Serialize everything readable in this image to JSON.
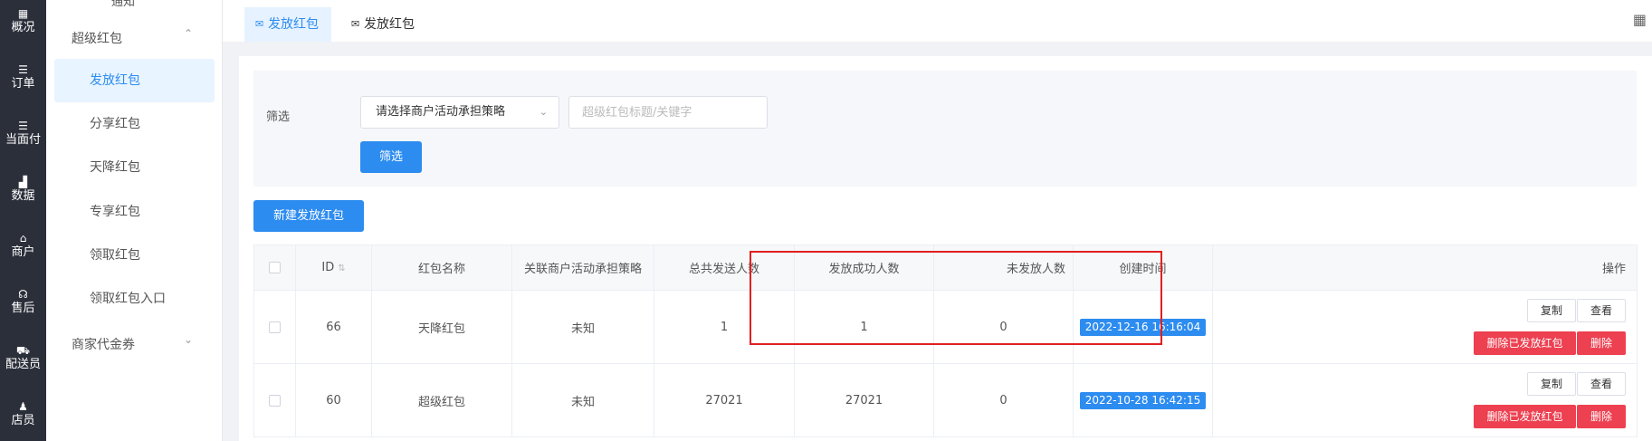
{
  "rail": [
    {
      "icon": "▦",
      "label": "概况"
    },
    {
      "icon": "☰",
      "label": "订单"
    },
    {
      "icon": "☰",
      "label": "当面付"
    },
    {
      "icon": "▟",
      "label": "数据"
    },
    {
      "icon": "⌂",
      "label": "商户"
    },
    {
      "icon": "☊",
      "label": "售后"
    },
    {
      "icon": "⛟",
      "label": "配送员"
    },
    {
      "icon": "♟",
      "label": "店员"
    }
  ],
  "submenu": {
    "partial_label": "通知",
    "group_super": "超级红包",
    "items": [
      "发放红包",
      "分享红包",
      "天降红包",
      "专享红包",
      "领取红包",
      "领取红包入口"
    ],
    "group_coupon": "商家代金券"
  },
  "tabs": [
    {
      "label": "发放红包",
      "icon": "✉"
    },
    {
      "label": "发放红包",
      "icon": "✉"
    }
  ],
  "filter": {
    "label": "筛选",
    "select_value": "请选择商户活动承担策略",
    "keyword_placeholder": "超级红包标题/关键字",
    "button": "筛选"
  },
  "new_button": "新建发放红包",
  "table": {
    "headers": {
      "id": "ID",
      "name": "红包名称",
      "strategy": "关联商户活动承担策略",
      "total": "总共发送人数",
      "success": "发放成功人数",
      "unsent": "未发放人数",
      "created": "创建时间",
      "ops": "操作"
    },
    "rows": [
      {
        "id": "66",
        "name": "天降红包",
        "strategy": "未知",
        "total": "1",
        "success": "1",
        "unsent": "0",
        "created": "2022-12-16 16:16:04"
      },
      {
        "id": "60",
        "name": "超级红包",
        "strategy": "未知",
        "total": "27021",
        "success": "27021",
        "unsent": "0",
        "created": "2022-10-28 16:42:15"
      }
    ],
    "row_actions": {
      "copy": "复制",
      "view": "查看",
      "delete_sent": "删除已发放红包",
      "delete": "删除"
    }
  },
  "colors": {
    "primary": "#2d8cf0",
    "danger": "#ed4050",
    "success": "#19be6b",
    "highlight": "#e02020"
  }
}
